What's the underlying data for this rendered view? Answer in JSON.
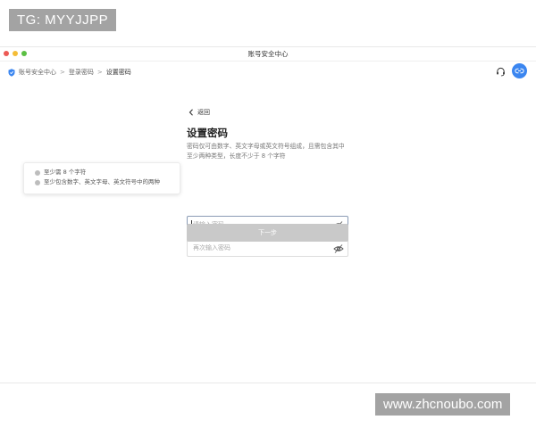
{
  "overlay": {
    "top_badge": "TG: MYYJJPP",
    "bottom_badge": "www.zhcnoubo.com"
  },
  "window": {
    "title": "账号安全中心"
  },
  "breadcrumb": {
    "items": [
      "账号安全中心",
      "登录密码",
      "设置密码"
    ],
    "separator": ">"
  },
  "toolbar": {
    "support_icon": "headset-icon",
    "avatar_icon": "link-icon"
  },
  "form": {
    "back_label": "返回",
    "title": "设置密码",
    "description": "密码仅可由数字、英文字母或英文符号组成，且需包含其中至少两种类型，长度不少于 8 个字符",
    "password": {
      "value": "",
      "placeholder": "请输入密码"
    },
    "confirm": {
      "value": "",
      "placeholder": "再次输入密码"
    },
    "next_label": "下一步"
  },
  "hints": {
    "items": [
      "至少需 8 个字符",
      "至少包含数字、英文字母、英文符号中的两种"
    ]
  },
  "colors": {
    "accent": "#3b86f0",
    "button_disabled": "#c9c9c9",
    "hint_dot": "#bdbdbd"
  }
}
